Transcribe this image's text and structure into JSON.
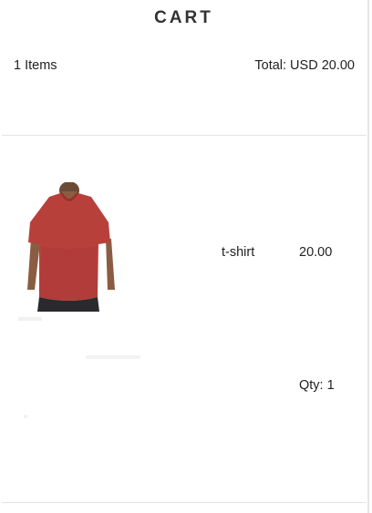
{
  "cart": {
    "title": "CART",
    "items_count": "1 Items",
    "total": "Total: USD 20.00"
  },
  "item": {
    "name": "t-shirt",
    "price": "20.00",
    "qty": "Qty: 1",
    "image_icon": "red-tshirt-image"
  },
  "colors": {
    "shirt": "#b8403b",
    "divider": "#e4e4e4",
    "text": "#222222"
  }
}
